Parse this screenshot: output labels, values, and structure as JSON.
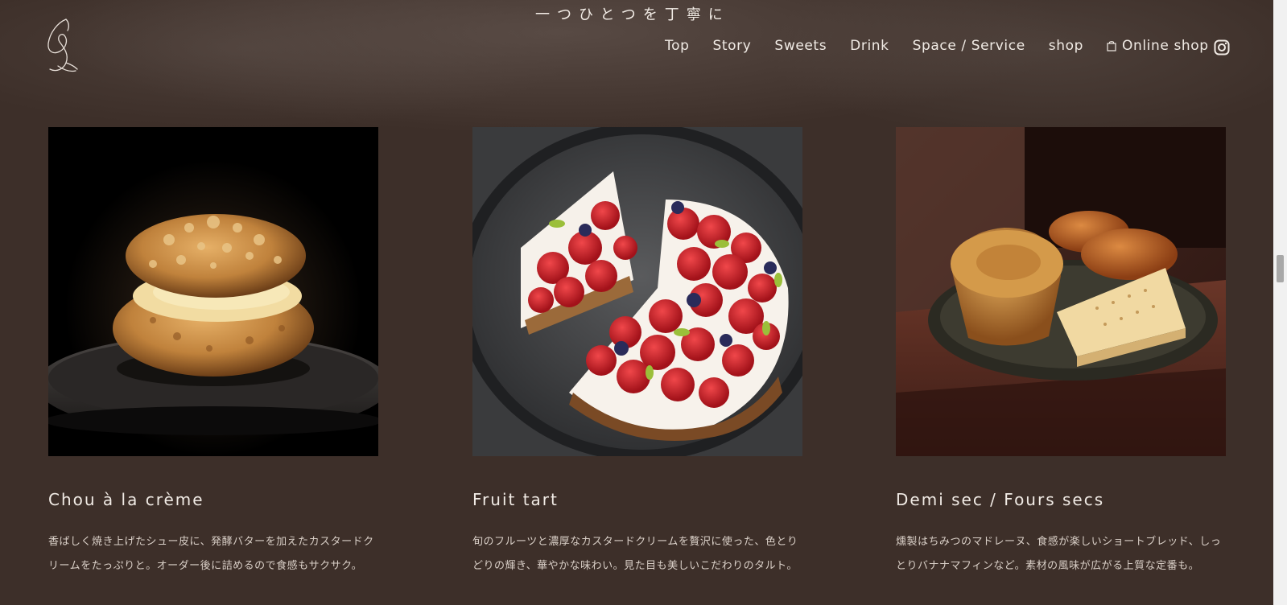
{
  "header": {
    "tagline": "一つひとつを丁寧に",
    "logo_icon": "swan-logo-icon",
    "nav": [
      {
        "label": "Top"
      },
      {
        "label": "Story"
      },
      {
        "label": "Sweets"
      },
      {
        "label": "Drink"
      },
      {
        "label": "Space / Service"
      },
      {
        "label": "shop"
      },
      {
        "label": "Online shop",
        "icon": "shopping-bag-icon"
      }
    ],
    "instagram_icon": "instagram-icon"
  },
  "cards": [
    {
      "title": "Chou à la crème",
      "desc": "香ばしく焼き上げたシュー皮に、発酵バターを加えたカスタードクリームをたっぷりと。オーダー後に詰めるので食感もサクサク。",
      "image": "cream-puff-photo"
    },
    {
      "title": "Fruit tart",
      "desc": "旬のフルーツと濃厚なカスタードクリームを贅沢に使った、色とりどりの輝き、華やかな味わい。見た目も美しいこだわりのタルト。",
      "image": "strawberry-tart-photo"
    },
    {
      "title": "Demi sec / Fours secs",
      "desc": "燻製はちみつのマドレーヌ、食感が楽しいショートブレッド、しっとりバナナマフィンなど。素材の風味が広がる上質な定番も。",
      "image": "baked-goods-photo"
    }
  ],
  "colors": {
    "background": "#3d2f29",
    "text": "#f1ebe5",
    "muted_text": "#d9cfc7"
  }
}
